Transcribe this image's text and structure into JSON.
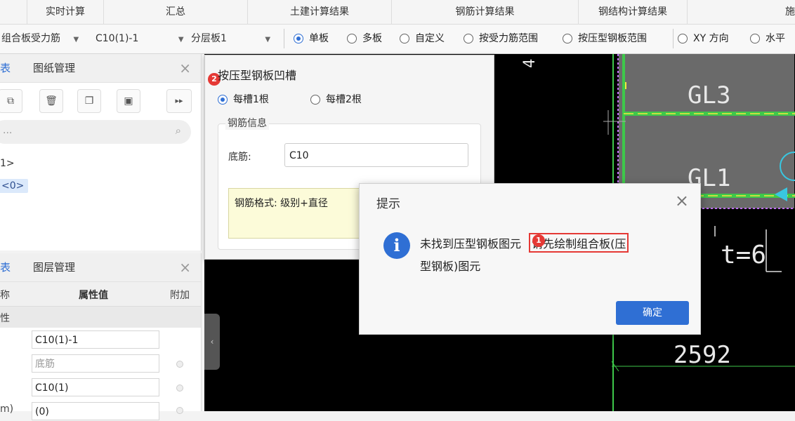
{
  "top_tabs": [
    "实时计算",
    "汇总",
    "土建计算结果",
    "钢筋计算结果",
    "钢结构计算结果",
    "施"
  ],
  "toolbar": {
    "combo1": "组合板受力筋",
    "combo2": "C10(1)-1",
    "combo3": "分层板1",
    "radios": [
      "单板",
      "多板",
      "自定义",
      "按受力筋范围",
      "按压型钢板范围",
      "XY 方向",
      "水平"
    ],
    "selected_radio": "单板"
  },
  "panel_top": {
    "tab1": "表",
    "tab2": "图纸管理",
    "search_placeholder": "...",
    "tree": [
      "1>",
      "<0>"
    ]
  },
  "panel_bottom": {
    "tab1": "表",
    "tab2": "图层管理",
    "col_name": "称",
    "col_value": "属性值",
    "col_extra": "附加",
    "group_label": "性",
    "rows": [
      {
        "value": "C10(1)-1"
      },
      {
        "value": "底筋"
      },
      {
        "value": "C10(1)"
      },
      {
        "label": "m)",
        "value": "(0)"
      }
    ]
  },
  "dialog1": {
    "title": "按压型钢板凹槽",
    "options": [
      "每槽1根",
      "每槽2根"
    ],
    "group_title": "钢筋信息",
    "field_label": "底筋:",
    "field_value": "C10",
    "hint": "钢筋格式: 级别+直径",
    "badge": "2"
  },
  "dialog2": {
    "title": "提示",
    "message_line1_a": "未找到压型钢板图元",
    "message_line1_b": "请先绘制组合板(压",
    "message_line2": "型钢板)图元",
    "ok_label": "确定",
    "badge": "1"
  },
  "cad": {
    "labels": [
      "GL3",
      "GL1",
      "t=6",
      "2592",
      "4"
    ]
  },
  "colors": {
    "accent": "#2f6fd4",
    "cad_bg": "#000000",
    "cad_green": "#3ec84a",
    "cad_yellow": "#f3e642",
    "highlight_red": "#e53935"
  }
}
